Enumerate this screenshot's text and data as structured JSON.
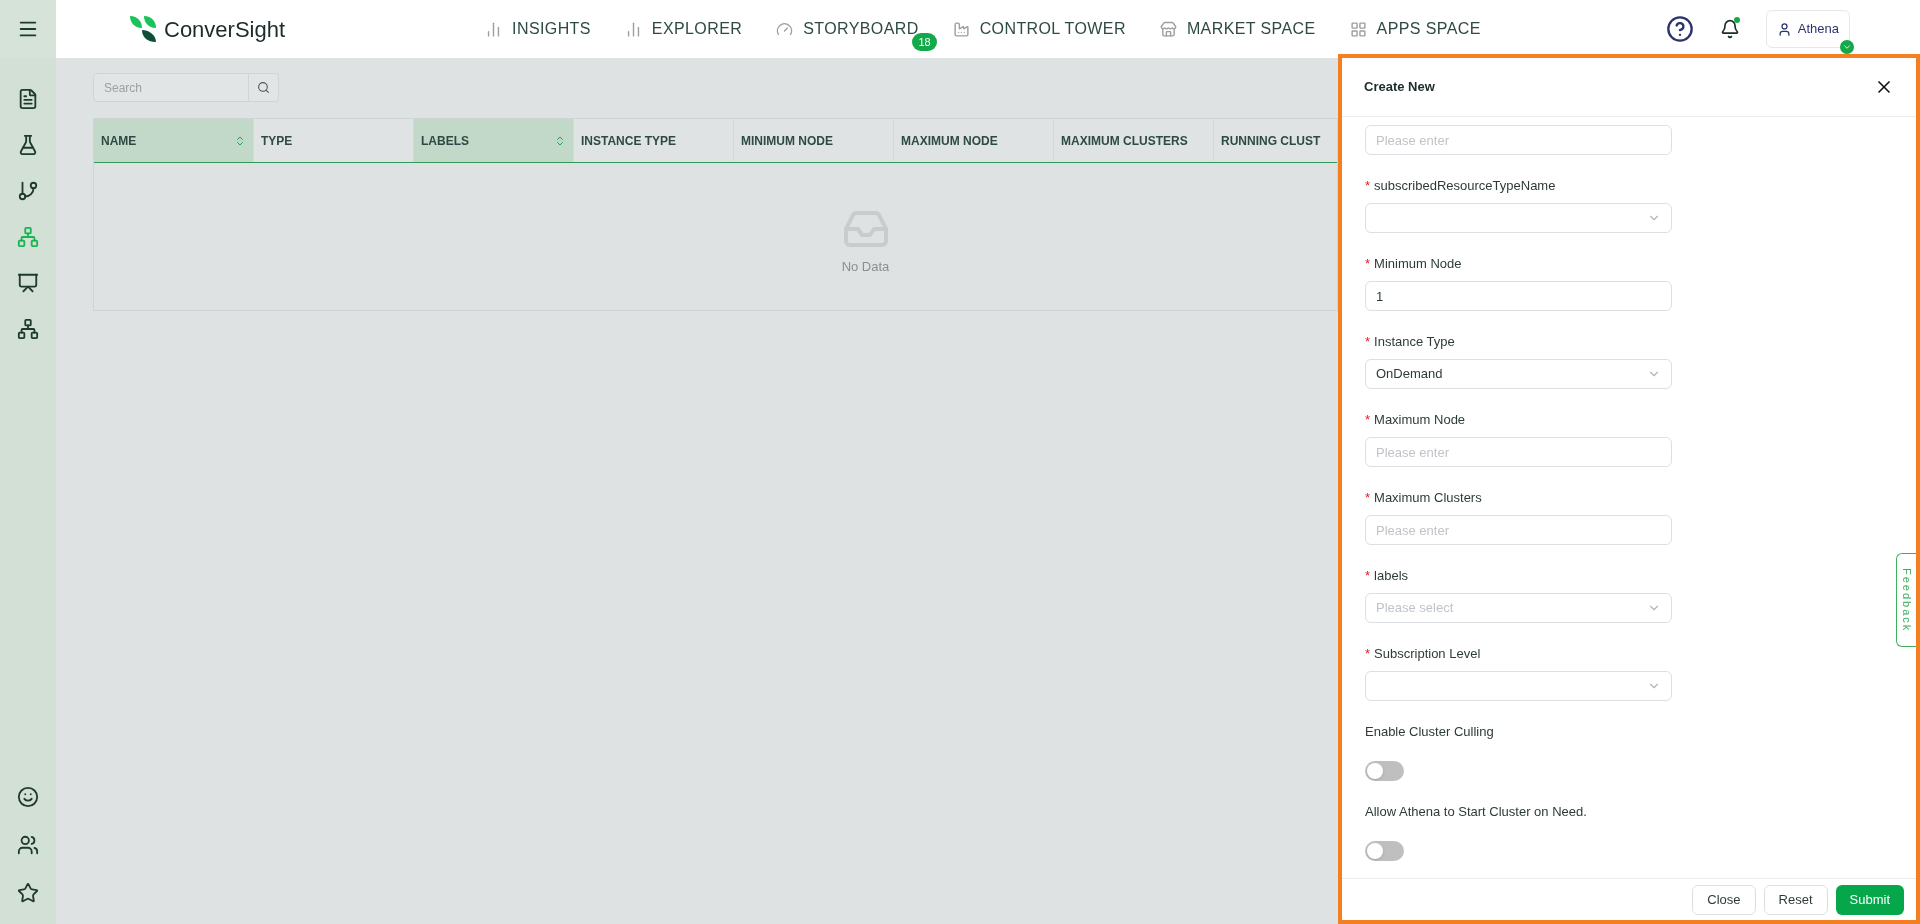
{
  "topbar": {
    "logo": "ConverSight",
    "nav": [
      {
        "label": "INSIGHTS",
        "kind": "bars"
      },
      {
        "label": "EXPLORER",
        "kind": "bars"
      },
      {
        "label": "STORYBOARD",
        "kind": "gauge",
        "badge": "18"
      },
      {
        "label": "CONTROL TOWER",
        "kind": "factory"
      },
      {
        "label": "MARKET SPACE",
        "kind": "store"
      },
      {
        "label": "APPS SPACE",
        "kind": "apps"
      }
    ],
    "notifications_unread": true,
    "user": "Athena"
  },
  "sidebar": {
    "items": [
      {
        "kind": "report",
        "selected": false
      },
      {
        "kind": "flask",
        "selected": false
      },
      {
        "kind": "branch",
        "selected": false
      },
      {
        "kind": "network",
        "selected": true
      },
      {
        "kind": "presentation",
        "selected": false
      },
      {
        "kind": "network",
        "selected": false
      }
    ],
    "bottom_items": [
      {
        "kind": "bot"
      },
      {
        "kind": "users"
      },
      {
        "kind": "star"
      }
    ]
  },
  "table": {
    "search": {
      "placeholder": "Search"
    },
    "columns": [
      {
        "label": "NAME",
        "sortable": true
      },
      {
        "label": "TYPE",
        "sortable": false
      },
      {
        "label": "LABELS",
        "sortable": true
      },
      {
        "label": "INSTANCE TYPE",
        "sortable": false
      },
      {
        "label": "MINIMUM NODE",
        "sortable": false
      },
      {
        "label": "MAXIMUM NODE",
        "sortable": false
      },
      {
        "label": "MAXIMUM CLUSTERS",
        "sortable": false
      },
      {
        "label": "RUNNING CLUST",
        "sortable": false
      }
    ],
    "empty_text": "No Data"
  },
  "drawer": {
    "title": "Create New",
    "fields": [
      {
        "kind": "input",
        "placeholder": "Please enter"
      },
      {
        "kind": "select",
        "label": "subscribedResourceTypeName",
        "required_mark": "*"
      },
      {
        "kind": "input",
        "label": "Minimum Node",
        "required_mark": "*",
        "value": "1"
      },
      {
        "kind": "select",
        "label": "Instance Type",
        "required_mark": "*",
        "value": "OnDemand"
      },
      {
        "kind": "input",
        "label": "Maximum Node",
        "required_mark": "*",
        "placeholder": "Please enter"
      },
      {
        "kind": "input",
        "label": "Maximum Clusters",
        "required_mark": "*",
        "placeholder": "Please enter"
      },
      {
        "kind": "select",
        "label": "labels",
        "required_mark": "*",
        "placeholder": "Please select"
      },
      {
        "kind": "select",
        "label": "Subscription Level",
        "required_mark": "*"
      },
      {
        "kind": "switch",
        "label": "Enable Cluster Culling",
        "on": false
      },
      {
        "kind": "switch",
        "label": "Allow Athena to Start Cluster on Need.",
        "on": false
      }
    ],
    "buttons": [
      {
        "label": "Close",
        "kind": "default"
      },
      {
        "label": "Reset",
        "kind": "default"
      },
      {
        "label": "Submit",
        "kind": "primary"
      }
    ]
  },
  "feedback": "Feedback"
}
